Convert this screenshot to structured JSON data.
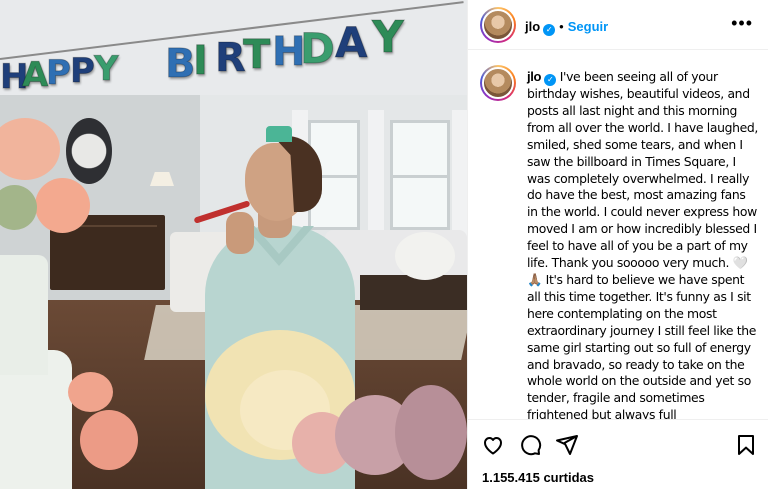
{
  "photo": {
    "banner_letters": [
      "H",
      "A",
      "P",
      "P",
      "Y",
      "B",
      "I",
      "R",
      "T",
      "H",
      "D",
      "A",
      "Y"
    ],
    "banner_colors": [
      "#1f3f7a",
      "#2e8b57",
      "#2f6fb3",
      "#1f3f7a",
      "#3a9d6e",
      "#2f6fb3",
      "#2e8b57",
      "#1f3f7a",
      "#2e8b57",
      "#2f6fb3",
      "#3a9d6e",
      "#1f3f7a",
      "#2e8b57"
    ]
  },
  "header": {
    "username": "jlo",
    "separator": "•",
    "follow_label": "Seguir",
    "more_label": "•••"
  },
  "caption": {
    "username": "jlo",
    "text": "I've been seeing all of your birthday wishes, beautiful videos, and posts all last night and this morning from all over the world. I have laughed, smiled, shed some tears, and when I saw the billboard in Times Square, I was completely overwhelmed. I really do have the best, most amazing fans in the world. I could never express how moved I am or how incredibly blessed I feel to have all of you be a part of my life. Thank you sooooo very much. 🤍🙏🏽 It's hard to believe we have spent all this time together. It's funny as I sit here contemplating on the most extraordinary journey I still feel like the same girl starting out so full of energy and bravado, so ready to take on the whole world on the outside and yet so tender, fragile and sometimes frightened but always full"
  },
  "actions": {
    "like_icon": "heart-icon",
    "comment_icon": "comment-icon",
    "share_icon": "share-icon",
    "save_icon": "bookmark-icon"
  },
  "likes": {
    "text": "1.155.415 curtidas"
  },
  "colors": {
    "accent": "#0095f6",
    "verified": "#0095f6"
  }
}
